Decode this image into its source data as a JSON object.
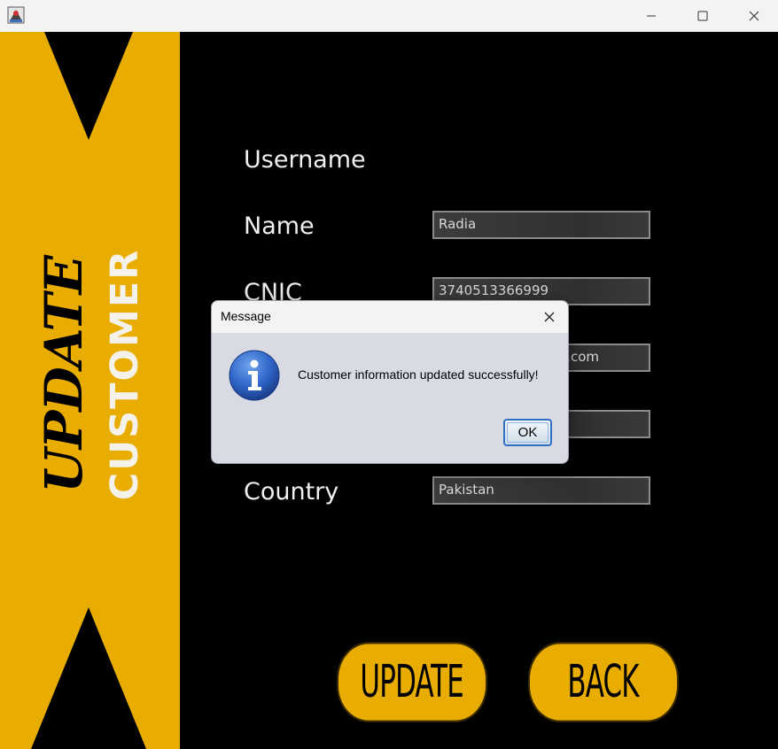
{
  "window": {
    "icons": {
      "app": "java-app-icon",
      "minimize": "minimize-icon",
      "maximize": "maximize-icon",
      "close": "close-icon"
    }
  },
  "sidebar": {
    "script_text": "UPDATE",
    "block_text": "CUSTOMER",
    "background_color": "#e8ad00"
  },
  "form": {
    "labels": {
      "username": "Username",
      "name": "Name",
      "cnic": "CNIC",
      "country": "Country"
    },
    "values": {
      "name": "Radia",
      "cnic": "3740513366999",
      "email_visible": ".com",
      "country": "Pakistan"
    }
  },
  "buttons": {
    "update": "UPDATE",
    "back": "BACK"
  },
  "dialog": {
    "title": "Message",
    "message": "Customer information updated successfully!",
    "ok_label": "OK",
    "icon": "info-icon"
  },
  "colors": {
    "accent": "#e8ad00",
    "background": "#000000",
    "dialog_bg": "#d8dbe4"
  }
}
